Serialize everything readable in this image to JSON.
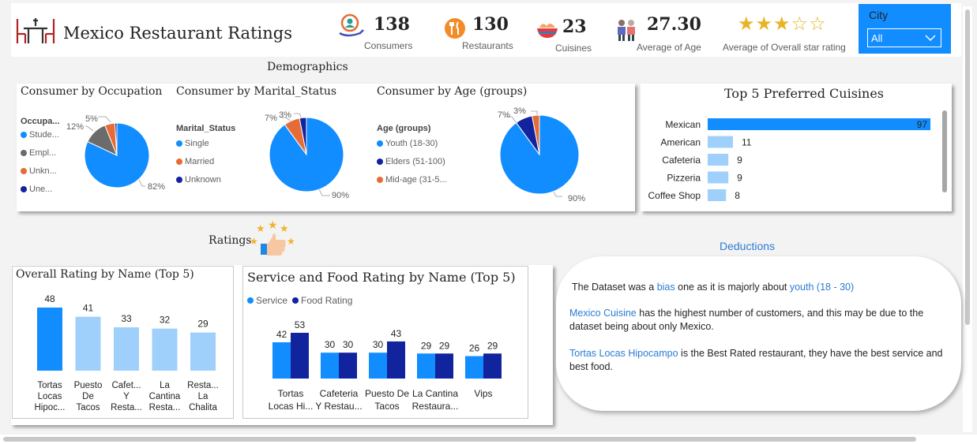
{
  "header": {
    "title": "Mexico Restaurant Ratings",
    "kpis": [
      {
        "value": "138",
        "label": "Consumers",
        "icon": "consumers-icon"
      },
      {
        "value": "130",
        "label": "Restaurants",
        "icon": "restaurant-icon"
      },
      {
        "value": "23",
        "label": "Cuisines",
        "icon": "cuisine-bowl-icon"
      },
      {
        "value": "27.30",
        "label": "Average of Age",
        "icon": "people-icon"
      }
    ],
    "star_rating": {
      "label": "Average of Overall star rating",
      "filled": 3,
      "max": 5,
      "color": "#e8b424"
    },
    "city_filter": {
      "label": "City",
      "selected": "All",
      "bg": "#118dff"
    }
  },
  "demographics": {
    "title": "Demographics",
    "occupation": {
      "title": "Consumer by Occupation",
      "legend_title": "Occupa...",
      "legend": [
        "Stude...",
        "Empl...",
        "Unkn...",
        "Une..."
      ],
      "labels": {
        "big": "82%",
        "a": "12%",
        "b": "5%"
      }
    },
    "marital": {
      "title": "Consumer by Marital_Status",
      "legend_title": "Marital_Status",
      "legend": [
        "Single",
        "Married",
        "Unknown"
      ],
      "labels": {
        "big": "90%",
        "a": "7%",
        "b": "3%"
      }
    },
    "age": {
      "title": "Consumer by Age (groups)",
      "legend_title": "Age (groups)",
      "legend": [
        "Youth (18-30)",
        "Elders (51-100)",
        "Mid-age (31-5..."
      ],
      "labels": {
        "big": "90%",
        "a": "7%",
        "b": "3%"
      }
    }
  },
  "ratings_section": {
    "title": "Ratings"
  },
  "deductions": {
    "title": "Deductions",
    "p1": {
      "a": "The Dataset was a ",
      "b": "bias",
      "c": " one as it is majorly about ",
      "d": "youth (18 - 30)"
    },
    "p2": {
      "a": "Mexico Cuisine",
      "b": " has the highest number of customers, and this may be due to the dataset being about only Mexico."
    },
    "p3": {
      "a": "Tortas Locas Hipocampo",
      "b": " is the Best Rated restaurant, they have the best service and best food."
    }
  },
  "colors": {
    "primary": "#118dff",
    "navy": "#12239e",
    "orange": "#e66c37",
    "gray": "#6b6b6b",
    "light": "#9fd0fb",
    "link": "#2b7cd3"
  },
  "chart_data": [
    {
      "type": "pie",
      "title": "Consumer by Occupation",
      "legend_title": "Occupa...",
      "categories": [
        "Stude...",
        "Empl...",
        "Unkn...",
        "Une..."
      ],
      "values": [
        82,
        12,
        5,
        1
      ],
      "colors": [
        "#118dff",
        "#6b6b6b",
        "#e66c37",
        "#12239e"
      ]
    },
    {
      "type": "pie",
      "title": "Consumer by Marital_Status",
      "legend_title": "Marital_Status",
      "categories": [
        "Single",
        "Married",
        "Unknown"
      ],
      "values": [
        90,
        7,
        3
      ],
      "colors": [
        "#118dff",
        "#e66c37",
        "#12239e"
      ]
    },
    {
      "type": "pie",
      "title": "Consumer by Age (groups)",
      "legend_title": "Age (groups)",
      "categories": [
        "Youth (18-30)",
        "Elders (51-100)",
        "Mid-age (31-5..."
      ],
      "values": [
        90,
        7,
        3
      ],
      "colors": [
        "#118dff",
        "#12239e",
        "#e66c37"
      ]
    },
    {
      "type": "bar",
      "orientation": "horizontal",
      "title": "Top 5 Preferred Cuisines",
      "categories": [
        "Mexican",
        "American",
        "Cafeteria",
        "Pizzeria",
        "Coffee Shop"
      ],
      "values": [
        97,
        11,
        9,
        9,
        8
      ],
      "xlim": [
        0,
        97
      ],
      "colors": [
        "#118dff",
        "#9fd0fb",
        "#9fd0fb",
        "#9fd0fb",
        "#9fd0fb"
      ]
    },
    {
      "type": "bar",
      "title": "Overall Rating by Name (Top 5)",
      "categories": [
        [
          "Tortas",
          "Locas",
          "Hipoc..."
        ],
        [
          "Puesto",
          "De",
          "Tacos"
        ],
        [
          "Cafet...",
          "Y",
          "Resta..."
        ],
        [
          "La",
          "Cantina",
          "Resta..."
        ],
        [
          "Resta...",
          "La",
          "Chalita"
        ]
      ],
      "values": [
        48,
        41,
        33,
        32,
        29
      ],
      "ylim": [
        0,
        48
      ],
      "colors": [
        "#118dff",
        "#9fd0fb",
        "#9fd0fb",
        "#9fd0fb",
        "#9fd0fb"
      ]
    },
    {
      "type": "bar",
      "title": "Service and Food Rating by Name (Top 5)",
      "categories": [
        [
          "Tortas",
          "Locas Hi..."
        ],
        [
          "Cafeteria",
          "Y Restau..."
        ],
        [
          "Puesto De",
          "Tacos"
        ],
        [
          "La Cantina",
          "Restaura..."
        ],
        [
          "Vips"
        ]
      ],
      "series": [
        {
          "name": "Service",
          "values": [
            42,
            30,
            30,
            29,
            26
          ],
          "color": "#118dff"
        },
        {
          "name": "Food Rating",
          "values": [
            53,
            30,
            43,
            29,
            29
          ],
          "color": "#12239e"
        }
      ],
      "ylim": [
        0,
        53
      ]
    }
  ]
}
